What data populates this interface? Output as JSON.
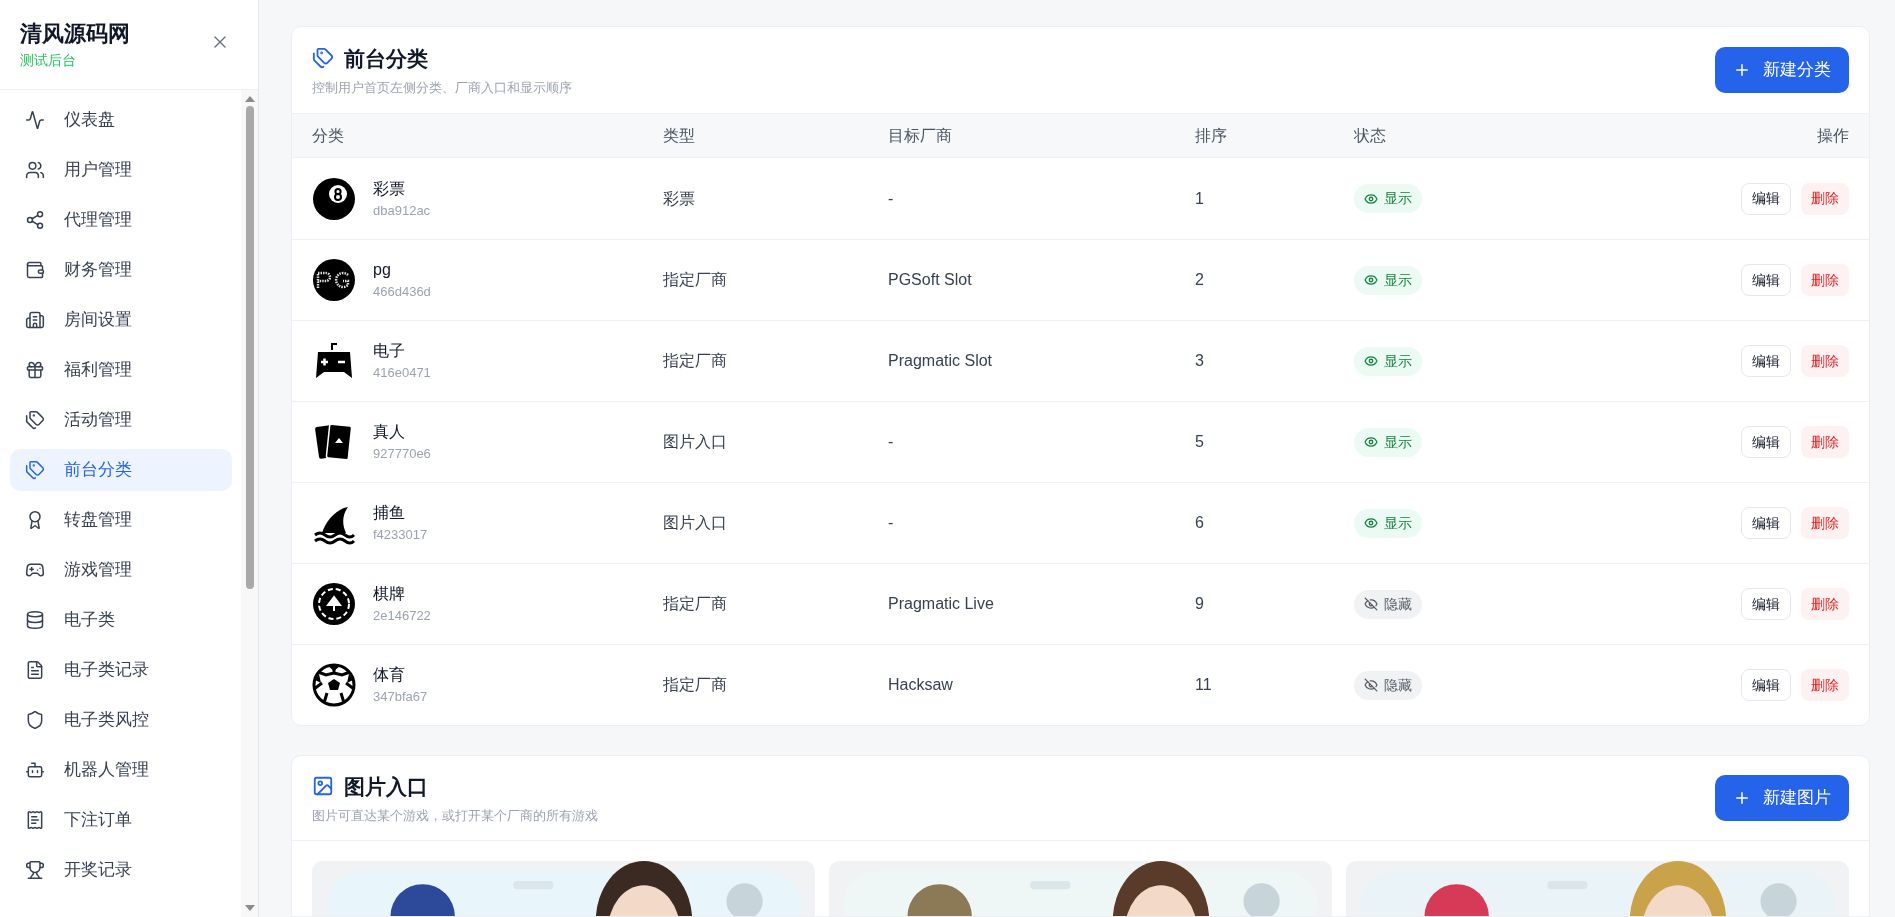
{
  "sidebar": {
    "brand": "清风源码网",
    "subtitle": "测试后台",
    "items": [
      {
        "label": "仪表盘",
        "selected": false
      },
      {
        "label": "用户管理",
        "selected": false
      },
      {
        "label": "代理管理",
        "selected": false
      },
      {
        "label": "财务管理",
        "selected": false
      },
      {
        "label": "房间设置",
        "selected": false
      },
      {
        "label": "福利管理",
        "selected": false
      },
      {
        "label": "活动管理",
        "selected": false
      },
      {
        "label": "前台分类",
        "selected": true
      },
      {
        "label": "转盘管理",
        "selected": false
      },
      {
        "label": "游戏管理",
        "selected": false
      },
      {
        "label": "电子类",
        "selected": false
      },
      {
        "label": "电子类记录",
        "selected": false
      },
      {
        "label": "电子类风控",
        "selected": false
      },
      {
        "label": "机器人管理",
        "selected": false
      },
      {
        "label": "下注订单",
        "selected": false
      },
      {
        "label": "开奖记录",
        "selected": false
      }
    ]
  },
  "categories": {
    "title": "前台分类",
    "subtitle": "控制用户首页左侧分类、厂商入口和显示顺序",
    "new_button": "新建分类",
    "columns": [
      "分类",
      "类型",
      "目标厂商",
      "排序",
      "状态",
      "操作"
    ],
    "rows": [
      {
        "name": "彩票",
        "id": "dba912ac",
        "type": "彩票",
        "vendor": "-",
        "order": "1",
        "visible": true,
        "status": "显示",
        "edit": "编辑",
        "delete": "删除"
      },
      {
        "name": "pg",
        "id": "466d436d",
        "type": "指定厂商",
        "vendor": "PGSoft Slot",
        "order": "2",
        "visible": true,
        "status": "显示",
        "edit": "编辑",
        "delete": "删除"
      },
      {
        "name": "电子",
        "id": "416e0471",
        "type": "指定厂商",
        "vendor": "Pragmatic Slot",
        "order": "3",
        "visible": true,
        "status": "显示",
        "edit": "编辑",
        "delete": "删除"
      },
      {
        "name": "真人",
        "id": "927770e6",
        "type": "图片入口",
        "vendor": "-",
        "order": "5",
        "visible": true,
        "status": "显示",
        "edit": "编辑",
        "delete": "删除"
      },
      {
        "name": "捕鱼",
        "id": "f4233017",
        "type": "图片入口",
        "vendor": "-",
        "order": "6",
        "visible": true,
        "status": "显示",
        "edit": "编辑",
        "delete": "删除"
      },
      {
        "name": "棋牌",
        "id": "2e146722",
        "type": "指定厂商",
        "vendor": "Pragmatic Live",
        "order": "9",
        "visible": false,
        "status": "隐藏",
        "edit": "编辑",
        "delete": "删除"
      },
      {
        "name": "体育",
        "id": "347bfa67",
        "type": "指定厂商",
        "vendor": "Hacksaw",
        "order": "11",
        "visible": false,
        "status": "隐藏",
        "edit": "编辑",
        "delete": "删除"
      }
    ]
  },
  "image_entries": {
    "title": "图片入口",
    "subtitle": "图片可直达某个游戏，或打开某个厂商的所有游戏",
    "new_button": "新建图片"
  }
}
